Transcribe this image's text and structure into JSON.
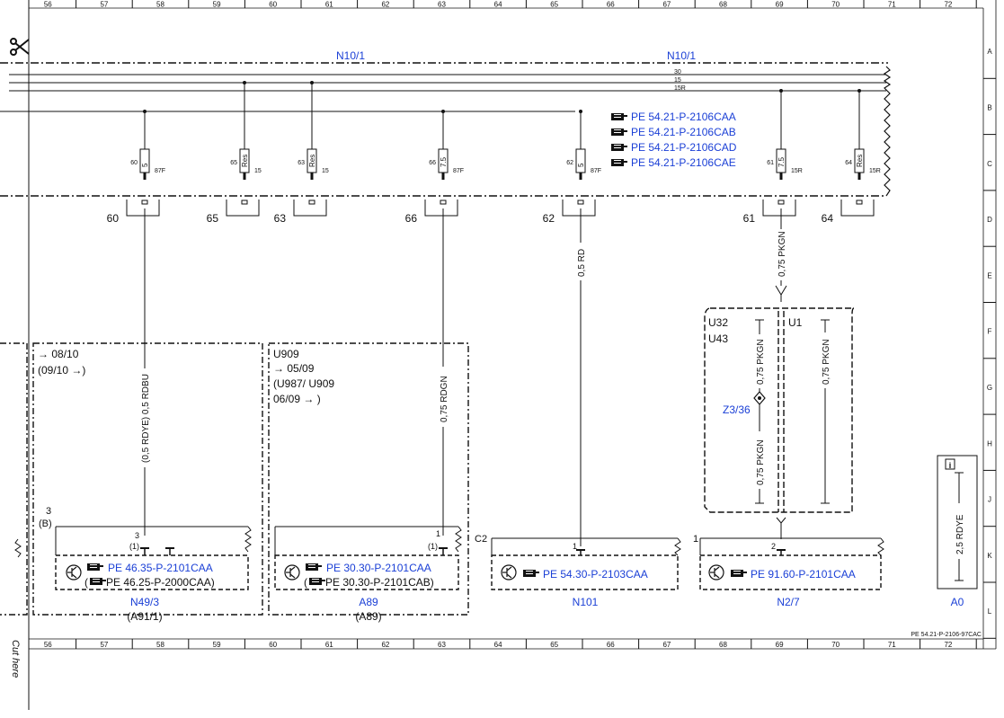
{
  "grid": {
    "columns": [
      "56",
      "57",
      "58",
      "59",
      "60",
      "61",
      "62",
      "63",
      "64",
      "65",
      "66",
      "67",
      "68",
      "69",
      "70",
      "71",
      "72"
    ],
    "rows": [
      "A",
      "B",
      "C",
      "D",
      "E",
      "F",
      "G",
      "H",
      "J",
      "K",
      "L"
    ]
  },
  "cut_label": "Cut here",
  "top_labels": {
    "left": "N10/1",
    "right": "N10/1"
  },
  "bus_labels": [
    "30",
    "15",
    "15R"
  ],
  "refs_top": [
    "PE 54.21-P-2106CAA",
    "PE 54.21-P-2106CAB",
    "PE 54.21-P-2106CAD",
    "PE 54.21-P-2106CAE"
  ],
  "fuses": [
    {
      "num": "60",
      "rating": "5",
      "term": "87F",
      "label": "60"
    },
    {
      "num": "65",
      "rating": "Res",
      "term": "15",
      "label": "65"
    },
    {
      "num": "63",
      "rating": "Res",
      "term": "15",
      "label": "63"
    },
    {
      "num": "66",
      "rating": "7.5",
      "term": "87F",
      "label": "66"
    },
    {
      "num": "62",
      "rating": "5",
      "term": "87F",
      "label": "62"
    },
    {
      "num": "61",
      "rating": "7.5",
      "term": "15R",
      "label": "61"
    },
    {
      "num": "64",
      "rating": "Res",
      "term": "15R",
      "label": "64"
    }
  ],
  "wires": {
    "w60": "(0,5 RDYE) 0,5 RDBU",
    "w66": "0,75 RDGN",
    "w62": "0,5 RD",
    "w61": "0,75 PKGN",
    "wu32a": "0,75 PKGN",
    "wu32b": "0,75 PKGN",
    "wu1": "0,75 PKGN",
    "wa0": "2,5 RDYE"
  },
  "box1": {
    "line1": "08/10",
    "line2": "(09/10",
    "pin_top": "3",
    "pin_top2": "(B)",
    "pin": "3",
    "pin2": "(1)",
    "ref1": "PE 46.35-P-2101CAA",
    "ref2": "PE 46.25-P-2000CAA",
    "ref2_open": "(",
    "ref2_close": ")",
    "name": "N49/3",
    "name2": "(A91/1)"
  },
  "box2": {
    "line1": "U909",
    "line2": "05/09",
    "line3": "(U987/ U909",
    "line4": "06/09",
    "line4_close": ")",
    "pin": "1",
    "pin2": "(1)",
    "ref1": "PE 30.30-P-2101CAA",
    "ref2": "PE 30.30-P-2101CAB",
    "ref2_open": "(",
    "ref2_close": ")",
    "name": "A89",
    "name2": "(A89)"
  },
  "box3": {
    "pin_c": "C2",
    "pin": "1",
    "ref": "PE 54.30-P-2103CAA",
    "name": "N101"
  },
  "box4": {
    "pin_ext": "1",
    "pin": "2",
    "ref": "PE 91.60-P-2101CAA",
    "name": "N2/7"
  },
  "variant": {
    "left1": "U32",
    "left2": "U43",
    "right": "U1",
    "splice": "Z3/36"
  },
  "a0": {
    "name": "A0"
  },
  "doc_id": "PE 54.21-P-2106-97CAC",
  "colors": {
    "accent": "#1a3fd6",
    "line": "#111111"
  }
}
